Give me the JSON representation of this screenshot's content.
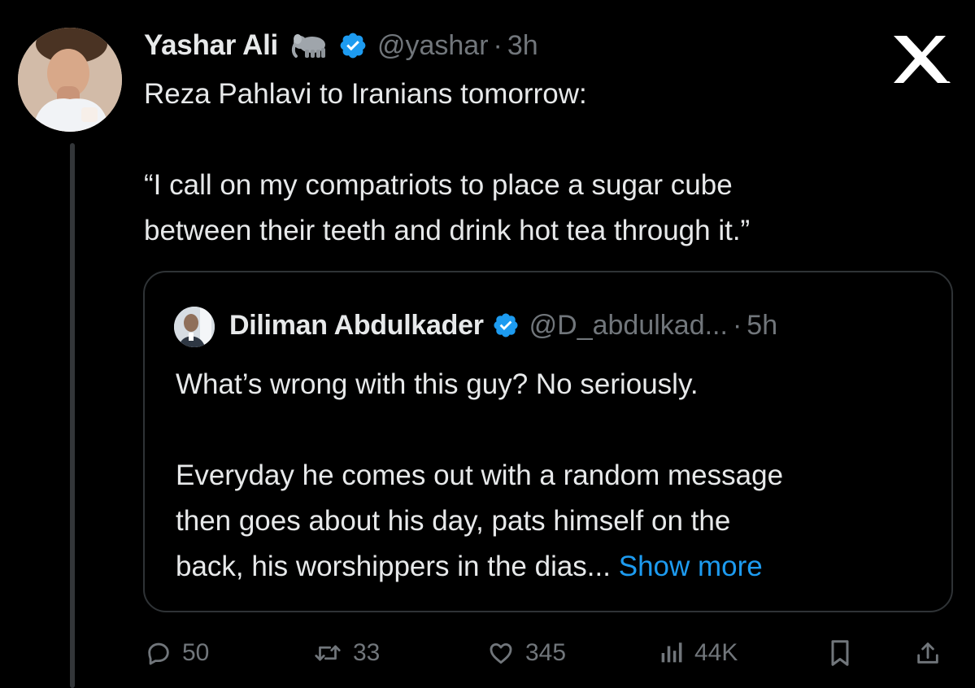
{
  "tweet": {
    "author_name": "Yashar Ali",
    "author_handle": "@yashar",
    "separator": "·",
    "time": "3h",
    "text_line1": "Reza Pahlavi to Iranians tomorrow:",
    "text_line2": "“I call on my compatriots to place a sugar cube",
    "text_line3": "between their teeth and drink hot tea through it.”"
  },
  "quote": {
    "author_name": "Diliman Abdulkader",
    "author_handle": "@D_abdulkad...",
    "separator": "·",
    "time": "5h",
    "text_line1": "What’s wrong with this guy? No seriously.",
    "text_line2": "Everyday he comes out with a random message",
    "text_line3": "then goes about his day, pats himself on the",
    "text_line4_prefix": "back, his worshippers in the dias...",
    "show_more": "Show more"
  },
  "actions": {
    "replies": "50",
    "reposts": "33",
    "likes": "345",
    "views": "44K"
  },
  "colors": {
    "background": "#000000",
    "text": "#e7e9ea",
    "secondary": "#71767b",
    "accent": "#1d9bf0",
    "border": "#2f3336"
  },
  "icons": {
    "badge": "elephant-icon",
    "verified": "verified-badge-icon",
    "brand": "x-logo-icon",
    "reply": "reply-icon",
    "repost": "repost-icon",
    "like": "heart-icon",
    "views": "views-icon",
    "bookmark": "bookmark-icon",
    "share": "share-icon"
  }
}
